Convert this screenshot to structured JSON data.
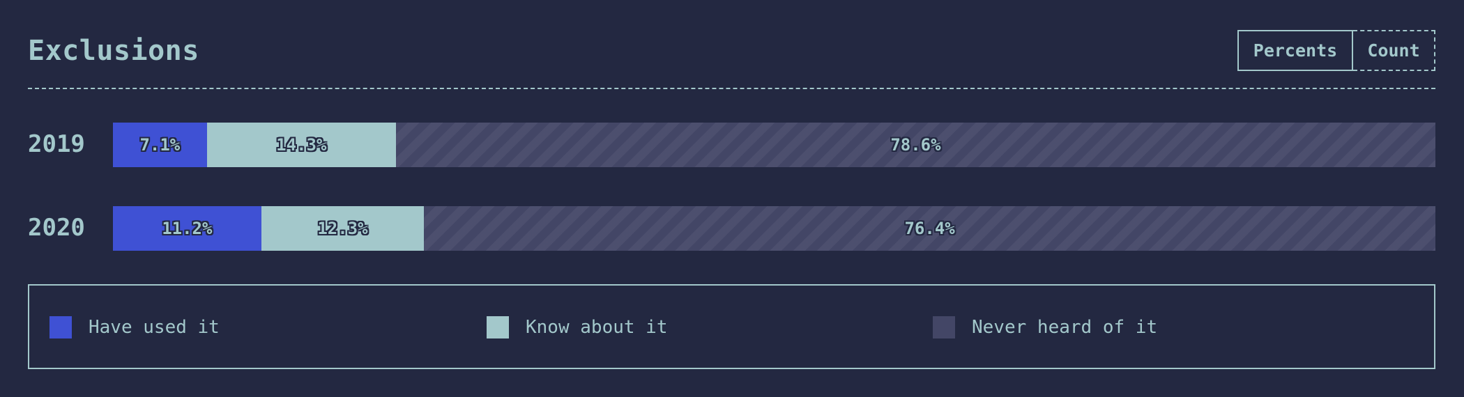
{
  "title": "Exclusions",
  "toggle": {
    "percents_label": "Percents",
    "count_label": "Count",
    "selected": "Percents"
  },
  "colors": {
    "background": "#232841",
    "text": "#a3c8cb",
    "have_used_it": "#3f51d4",
    "know_about_it": "#a3c8cb",
    "never_heard_of_it": "#434666"
  },
  "legend": {
    "items": [
      {
        "label": "Have used it",
        "color": "#3f51d4"
      },
      {
        "label": "Know about it",
        "color": "#a3c8cb"
      },
      {
        "label": "Never heard of it",
        "color": "#434666"
      }
    ]
  },
  "chart_data": {
    "type": "bar",
    "orientation": "horizontal",
    "stacked": true,
    "unit": "%",
    "categories": [
      "2019",
      "2020"
    ],
    "series": [
      {
        "name": "Have used it",
        "values": [
          7.1,
          11.2
        ],
        "labels": [
          "7.1%",
          "11.2%"
        ]
      },
      {
        "name": "Know about it",
        "values": [
          14.3,
          12.3
        ],
        "labels": [
          "14.3%",
          "12.3%"
        ]
      },
      {
        "name": "Never heard of it",
        "values": [
          78.6,
          76.4
        ],
        "labels": [
          "78.6%",
          "76.4%"
        ]
      }
    ],
    "title": "Exclusions",
    "xlim": [
      0,
      100
    ],
    "legend_position": "bottom",
    "grid": false
  }
}
